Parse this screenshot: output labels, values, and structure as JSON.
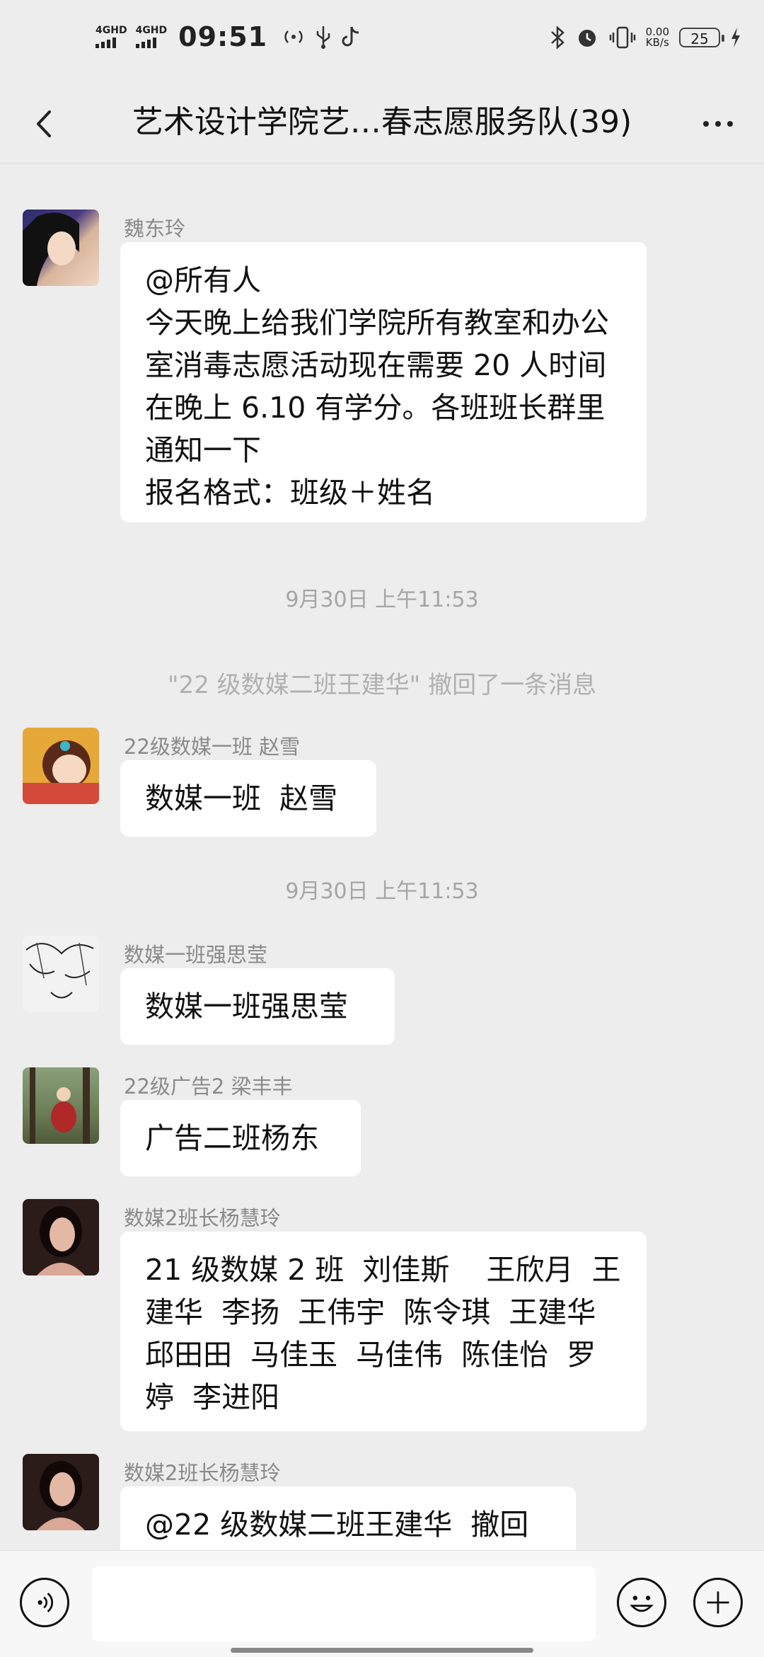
{
  "status_bar": {
    "network1": "4GHD",
    "network2": "4GHD",
    "time": "09:51",
    "net_speed_value": "0.00",
    "net_speed_unit": "KB/s",
    "battery": "25",
    "icons": [
      "signal-icon",
      "wifi-hotspot-icon",
      "usb-icon",
      "tiktok-icon",
      "bluetooth-icon",
      "alarm-icon",
      "vibrate-icon",
      "charging-icon"
    ]
  },
  "header": {
    "title": "艺术设计学院艺…春志愿服务队(39)",
    "back_icon": "chevron-left-icon",
    "more_icon": "more-dots-icon"
  },
  "messages": [
    {
      "sender": "魏东玲",
      "text": "@所有人\n今天晚上给我们学院所有教室和办公室消毒志愿活动现在需要 20 人时间在晚上 6.10 有学分。各班班长群里通知一下\n报名格式：班级＋姓名"
    },
    {
      "sender": "22级数媒一班  赵雪",
      "text": "数媒一班  赵雪"
    },
    {
      "sender": "数媒一班强思莹",
      "text": "数媒一班强思莹"
    },
    {
      "sender": "22级广告2  梁丰丰",
      "text": "广告二班杨东"
    },
    {
      "sender": "数媒2班长杨慧玲",
      "text": "21 级数媒 2 班  刘佳斯    王欣月  王建华  李扬  王伟宇  陈令琪  王建华  邱田田  马佳玉  马佳伟  陈佳怡  罗婷  李进阳"
    },
    {
      "sender": "数媒2班长杨慧玲",
      "text": "@22 级数媒二班王建华  撤回"
    }
  ],
  "timestamps": [
    "9月30日  上午11:53",
    "9月30日  上午11:53"
  ],
  "system_notice": "\"22 级数媒二班王建华\" 撤回了一条消息",
  "input_bar": {
    "voice_icon": "voice-icon",
    "emoji_icon": "emoji-icon",
    "plus_icon": "plus-icon",
    "placeholder": ""
  }
}
